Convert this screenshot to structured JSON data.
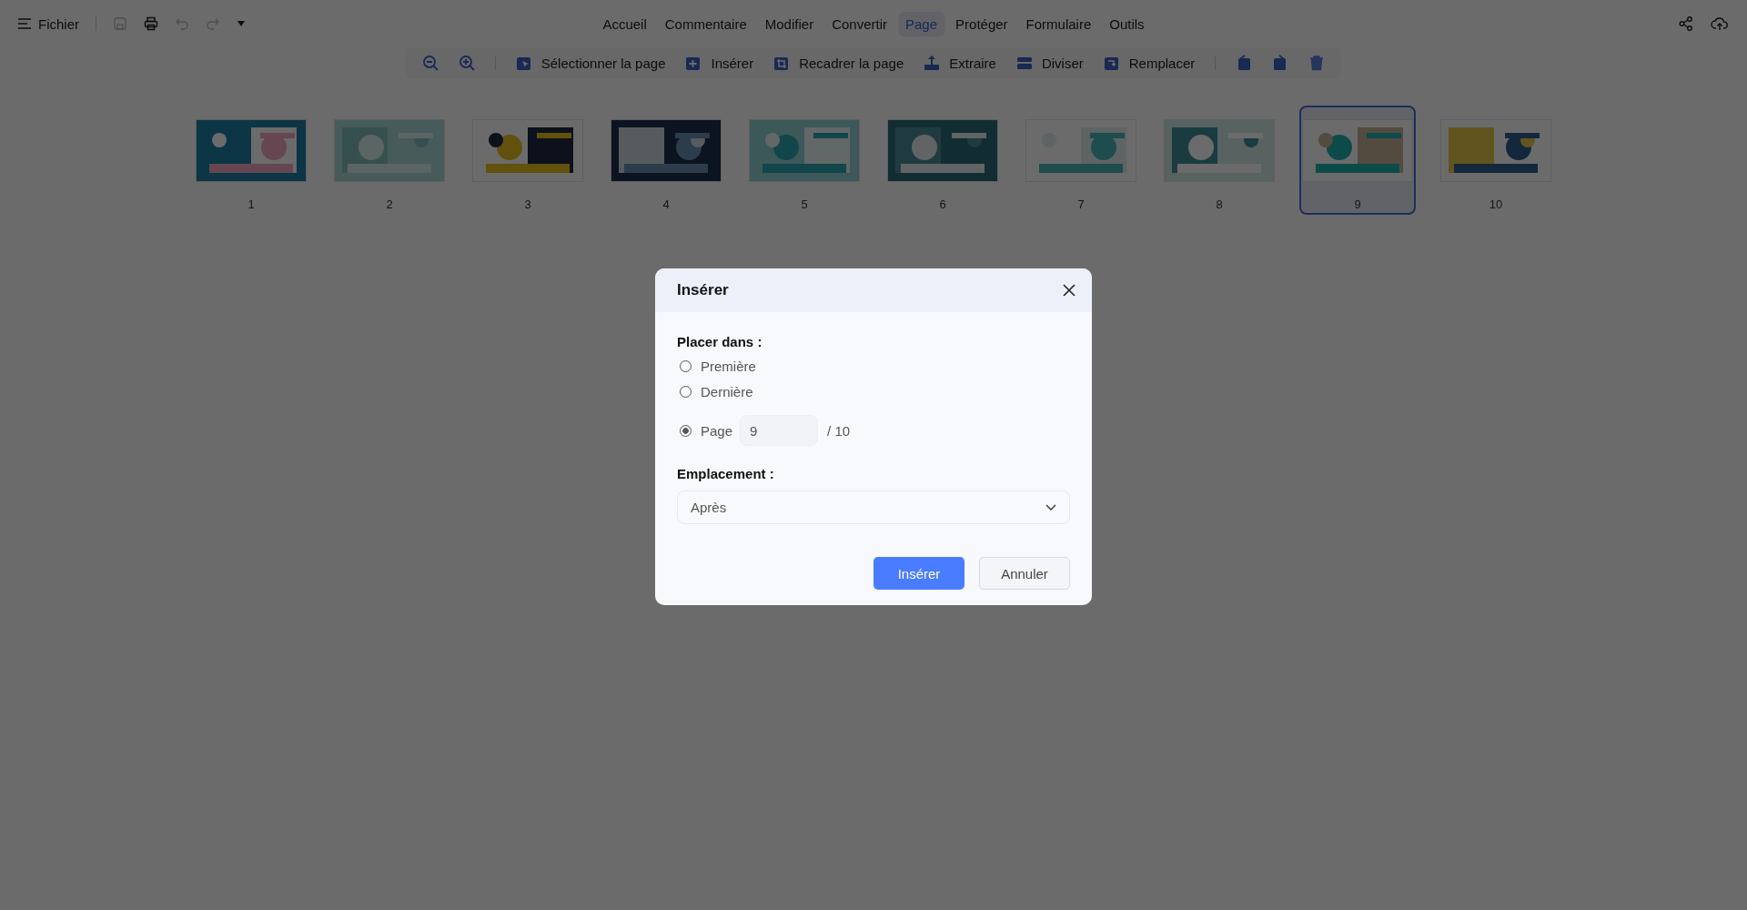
{
  "menu": {
    "label": "Fichier"
  },
  "quick_tools": [
    {
      "disabled": true
    },
    {
      "disabled": false
    },
    {
      "disabled": true
    },
    {
      "disabled": true
    }
  ],
  "tabs": [
    {
      "label": "Accueil",
      "selected": false
    },
    {
      "label": "Commentaire",
      "selected": false
    },
    {
      "label": "Modifier",
      "selected": false
    },
    {
      "label": "Convertir",
      "selected": false
    },
    {
      "label": "Page",
      "selected": true
    },
    {
      "label": "Protéger",
      "selected": false
    },
    {
      "label": "Formulaire",
      "selected": false
    },
    {
      "label": "Outils",
      "selected": false
    }
  ],
  "toolbar": {
    "labeled": [
      "Sélectionner la page",
      "Insérer",
      "Recadrer la page",
      "Extraire",
      "Diviser",
      "Remplacer"
    ]
  },
  "thumbnails": [
    {
      "number": "1",
      "selected": false
    },
    {
      "number": "2",
      "selected": false
    },
    {
      "number": "3",
      "selected": false
    },
    {
      "number": "4",
      "selected": false
    },
    {
      "number": "5",
      "selected": false
    },
    {
      "number": "6",
      "selected": false
    },
    {
      "number": "7",
      "selected": false
    },
    {
      "number": "8",
      "selected": false
    },
    {
      "number": "9",
      "selected": true
    },
    {
      "number": "10",
      "selected": false
    }
  ],
  "dialog": {
    "title": "Insérer",
    "placement_label": "Placer dans :",
    "options": [
      {
        "kind": "plain",
        "label": "Première",
        "selected": false
      },
      {
        "kind": "plain",
        "label": "Dernière",
        "selected": false
      },
      {
        "kind": "page",
        "label": "Page",
        "selected": true
      }
    ],
    "page_value": "9",
    "page_total": "/ 10",
    "location_label": "Emplacement :",
    "location_value": "Après",
    "confirm": "Insérer",
    "cancel": "Annuler"
  }
}
